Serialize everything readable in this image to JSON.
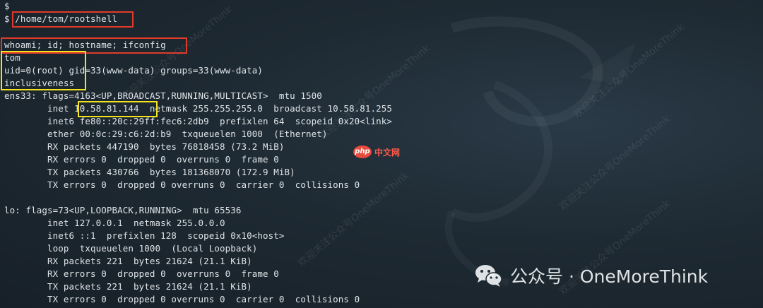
{
  "terminal": {
    "lines": [
      "$",
      "$ /home/tom/rootshell",
      "",
      "whoami; id; hostname; ifconfig",
      "tom",
      "uid=0(root) gid=33(www-data) groups=33(www-data)",
      "inclusiveness",
      "ens33: flags=4163<UP,BROADCAST,RUNNING,MULTICAST>  mtu 1500",
      "        inet 10.58.81.144  netmask 255.255.255.0  broadcast 10.58.81.255",
      "        inet6 fe80::20c:29ff:fec6:2db9  prefixlen 64  scopeid 0x20<link>",
      "        ether 00:0c:29:c6:2d:b9  txqueuelen 1000  (Ethernet)",
      "        RX packets 447190  bytes 76818458 (73.2 MiB)",
      "        RX errors 0  dropped 0  overruns 0  frame 0",
      "        TX packets 430766  bytes 181368070 (172.9 MiB)",
      "        TX errors 0  dropped 0 overruns 0  carrier 0  collisions 0",
      "",
      "lo: flags=73<UP,LOOPBACK,RUNNING>  mtu 65536",
      "        inet 127.0.0.1  netmask 255.0.0.0",
      "        inet6 ::1  prefixlen 128  scopeid 0x10<host>",
      "        loop  txqueuelen 1000  (Local Loopback)",
      "        RX packets 221  bytes 21624 (21.1 KiB)",
      "        RX errors 0  dropped 0  overruns 0  frame 0",
      "        TX packets 221  bytes 21624 (21.1 KiB)",
      "        TX errors 0  dropped 0 overruns 0  carrier 0  collisions 0"
    ]
  },
  "watermark": {
    "text": "欢迎关注公众号OneMoreThink"
  },
  "php_badge": {
    "logo": "php",
    "label": "中文网"
  },
  "brand": {
    "icon": "wechat-icon",
    "label": "公众号 · OneMoreThink"
  },
  "colors": {
    "highlight_red": "#e23a2a",
    "highlight_yellow": "#f4e31c"
  }
}
